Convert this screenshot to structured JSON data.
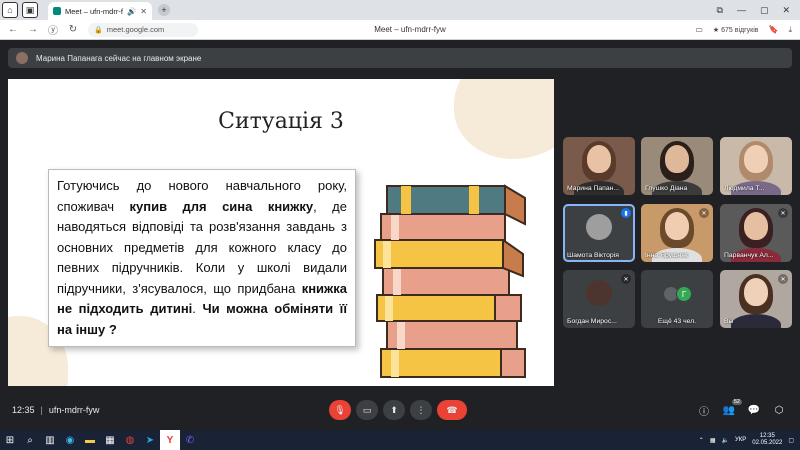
{
  "browser": {
    "tab_title": "Meet – ufn-mdrr-fyw",
    "url": "meet.google.com",
    "page_title": "Meet – ufn-mdrr-fyw",
    "reviews": "★ 675 відгуків",
    "new_tab": "+"
  },
  "notice": {
    "text": "Марина Папанага сейчас на главном экране"
  },
  "slide": {
    "title": "Ситуація 3",
    "body_segments": [
      {
        "t": "Готуючись до нового навчального року, споживач ",
        "b": false
      },
      {
        "t": "купив для сина книжку",
        "b": true
      },
      {
        "t": ", де наводяться відповіді та розв'язання завдань з основних предметів для кожного класу до певних підручників. Коли у школі видали підручники, з'ясувалося, що придбана ",
        "b": false
      },
      {
        "t": "книжка не підходить дитині",
        "b": true
      },
      {
        "t": ". ",
        "b": false
      },
      {
        "t": "Чи можна обміняти її на іншу ?",
        "b": true
      }
    ]
  },
  "participants": [
    {
      "name": "Марина Папан...",
      "muted": false,
      "talking": false
    },
    {
      "name": "Глушко Діана",
      "muted": false,
      "talking": false
    },
    {
      "name": "Людмила Т...",
      "muted": false,
      "talking": false
    },
    {
      "name": "Шамота Вікторія",
      "muted": false,
      "talking": true
    },
    {
      "name": "Інна Ярушняк",
      "muted": true,
      "talking": false
    },
    {
      "name": "Парванчук Ал...",
      "muted": true,
      "talking": false
    },
    {
      "name": "Богдан Мирос...",
      "muted": true,
      "talking": false
    },
    {
      "name": "Ещё 43 чел.",
      "muted": false,
      "talking": false,
      "letter": "Г"
    },
    {
      "name": "Вы",
      "muted": true,
      "talking": false
    }
  ],
  "meeting": {
    "time": "12:35",
    "separator": "|",
    "code": "ufn-mdrr-fyw",
    "people_count": "52"
  },
  "taskbar": {
    "lang": "УКР",
    "time": "12:35",
    "date": "02.05.2022"
  },
  "colors": {
    "meet_bg": "#202124",
    "tile_bg": "#3c4043",
    "accent": "#1a73e8",
    "hangup": "#ea4335"
  }
}
